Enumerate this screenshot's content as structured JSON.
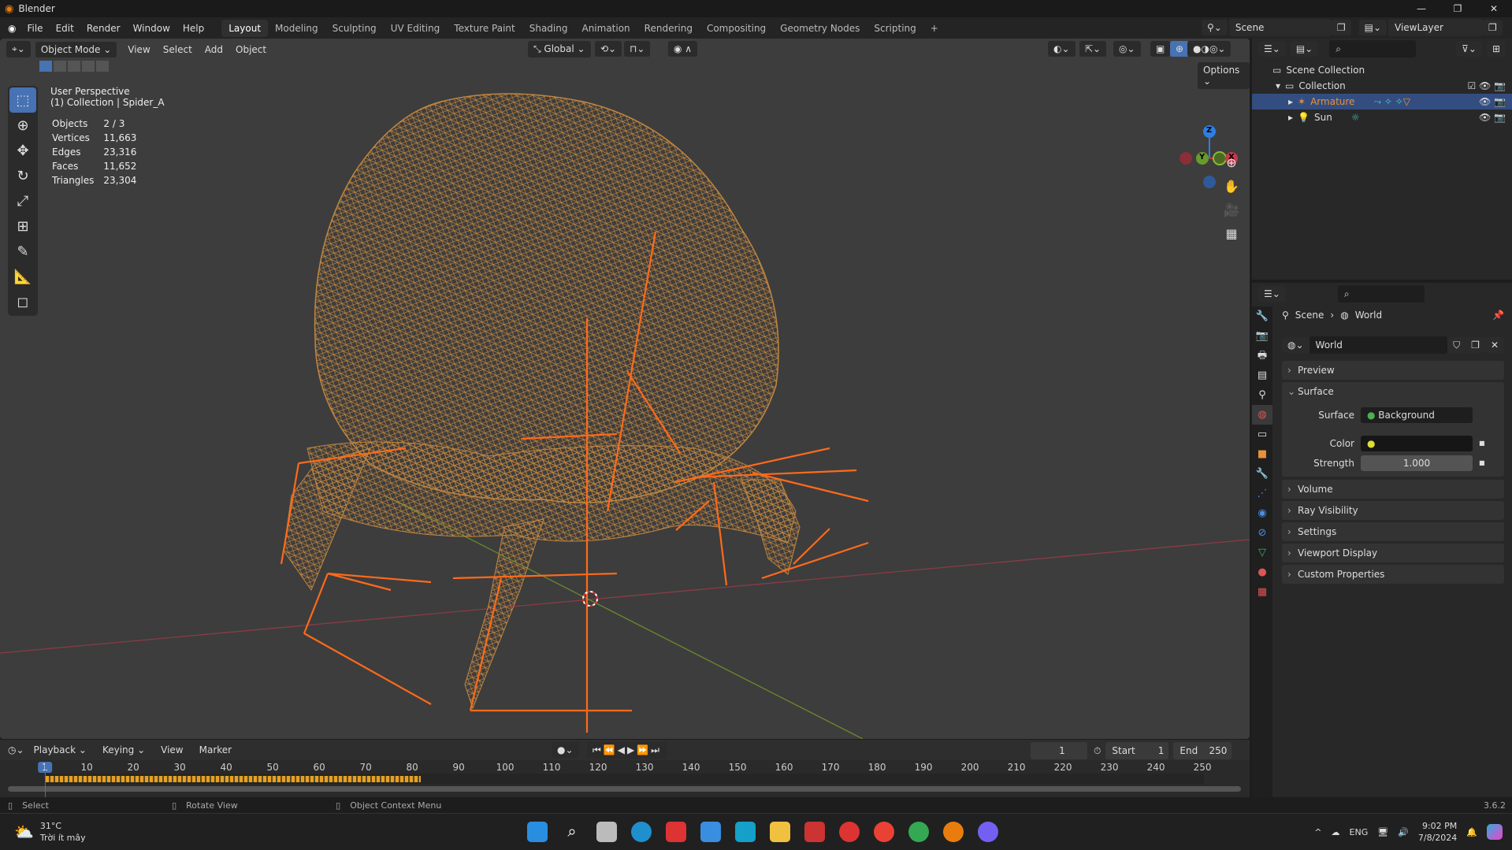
{
  "title": "Blender",
  "menu": [
    "File",
    "Edit",
    "Render",
    "Window",
    "Help"
  ],
  "workspaces": [
    "Layout",
    "Modeling",
    "Sculpting",
    "UV Editing",
    "Texture Paint",
    "Shading",
    "Animation",
    "Rendering",
    "Compositing",
    "Geometry Nodes",
    "Scripting"
  ],
  "scene": "Scene",
  "view_layer": "ViewLayer",
  "viewport": {
    "mode": "Object Mode",
    "menus": [
      "View",
      "Select",
      "Add",
      "Object"
    ],
    "orientation": "Global",
    "options": "Options",
    "overlay_title": "User Perspective",
    "overlay_sub": "(1) Collection | Spider_A",
    "stats": [
      [
        "Objects",
        "2 / 3"
      ],
      [
        "Vertices",
        "11,663"
      ],
      [
        "Edges",
        "23,316"
      ],
      [
        "Faces",
        "11,652"
      ],
      [
        "Triangles",
        "23,304"
      ]
    ],
    "gizmo": {
      "z": "Z",
      "y": "Y",
      "x": "X"
    }
  },
  "outliner": {
    "root": "Scene Collection",
    "collection": "Collection",
    "items": [
      "Armature",
      "Sun"
    ]
  },
  "properties": {
    "breadcrumb": [
      "Scene",
      "World"
    ],
    "world_name": "World",
    "panels": [
      "Preview",
      "Surface",
      "Volume",
      "Ray Visibility",
      "Settings",
      "Viewport Display",
      "Custom Properties"
    ],
    "surface_label": "Surface",
    "surface_value": "Background",
    "color_label": "Color",
    "strength_label": "Strength",
    "strength_value": "1.000"
  },
  "timeline": {
    "menus": [
      "Playback",
      "Keying",
      "View",
      "Marker"
    ],
    "current_frame": "1",
    "start_label": "Start",
    "start": "1",
    "end_label": "End",
    "end": "250",
    "ticks": [
      "1",
      "10",
      "20",
      "30",
      "40",
      "50",
      "60",
      "70",
      "80",
      "90",
      "100",
      "110",
      "120",
      "130",
      "140",
      "150",
      "160",
      "170",
      "180",
      "190",
      "200",
      "210",
      "220",
      "230",
      "240",
      "250"
    ]
  },
  "status": {
    "select": "Select",
    "rotate": "Rotate View",
    "context": "Object Context Menu",
    "version": "3.6.2"
  },
  "taskbar": {
    "temp": "31°C",
    "weather": "Trời ít mây",
    "lang": "ENG",
    "time": "9:02 PM",
    "date": "7/8/2024"
  }
}
